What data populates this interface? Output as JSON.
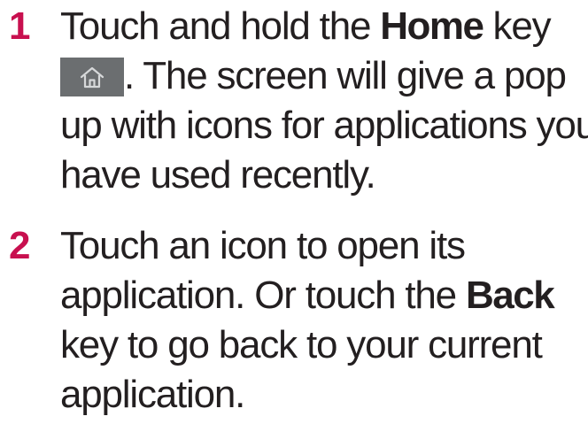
{
  "steps": [
    {
      "number": "1",
      "line1_pre": "Touch and hold the ",
      "line1_bold": "Home",
      "line1_post": " key",
      "line2": ". The screen will give a pop",
      "line3": "up with icons for applications you",
      "line4": "have used recently.",
      "key_icon": "home-icon"
    },
    {
      "number": "2",
      "line1": "Touch an icon to open its",
      "line2_pre": "application. Or touch the ",
      "line2_bold": "Back",
      "line3": "key to go back to your current",
      "line4": "application."
    }
  ],
  "colors": {
    "step_number": "#c8104f",
    "text": "#231f20",
    "key_background": "#6b6e70"
  }
}
